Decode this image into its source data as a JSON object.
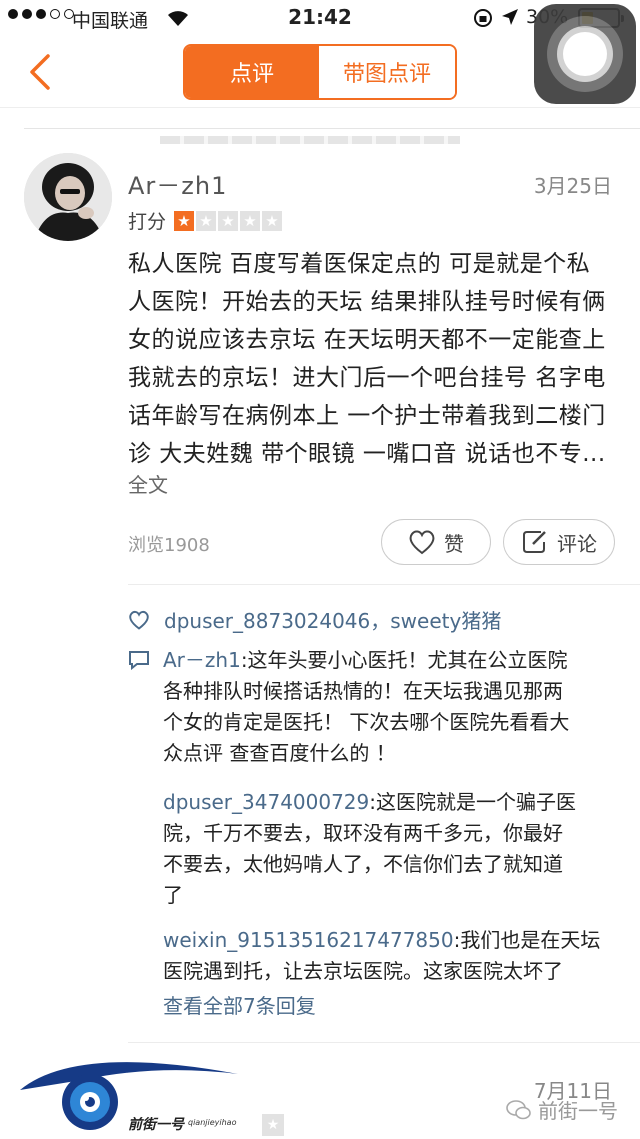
{
  "status_bar": {
    "carrier": "中国联通",
    "time": "21:42",
    "battery": "30%"
  },
  "nav": {
    "tab_review": "点评",
    "tab_photo_review": "带图点评"
  },
  "review": {
    "username": "Ar－zh1",
    "date": "3月25日",
    "rating_label": "打分",
    "rating_value": 1,
    "rating_max": 5,
    "lines": [
      "私人医院 百度写着医保定点的 可是就是个私",
      "人医院！开始去的天坛 结果排队挂号时候有俩",
      "女的说应该去京坛 在天坛明天都不一定能查上",
      "我就去的京坛！进大门后一个吧台挂号 名字电",
      "话年龄写在病例本上 一个护士带着我到二楼门",
      "诊 大夫姓魏 带个眼镜 一嘴口音 说话也不专..."
    ],
    "full_text_link": "全文",
    "views": "浏览1908",
    "like_label": "赞",
    "comment_label": "评论",
    "liked_by": "dpuser_8873024046，sweety猪猪",
    "comments": [
      {
        "author": "Ar－zh1",
        "lines": [
          ":这年头要小心医托！尤其在公立医院",
          "各种排队时候搭话热情的！在天坛我遇见那两",
          "个女的肯定是医托！ 下次去哪个医院先看看大",
          "众点评 查查百度什么的 ！"
        ]
      },
      {
        "author": "dpuser_3474000729",
        "lines": [
          ":这医院就是一个骗子医",
          "院，千万不要去，取环没有两千多元，你最好",
          "不要去，太他妈啃人了，不信你们去了就知道",
          "了"
        ]
      },
      {
        "author": "weixin_91513516217477850",
        "lines": [
          ":我们也是在天坛",
          "医院遇到托，让去京坛医院。这家医院太坏了"
        ]
      }
    ],
    "view_all_replies": "查看全部7条回复"
  },
  "next_review": {
    "date": "7月11日"
  },
  "watermark": {
    "logo_text": "前街一号",
    "logo_subtext": "qianjieyihao",
    "account": "前街一号"
  },
  "colors": {
    "accent": "#f36d21",
    "link": "#4a6a8a"
  }
}
